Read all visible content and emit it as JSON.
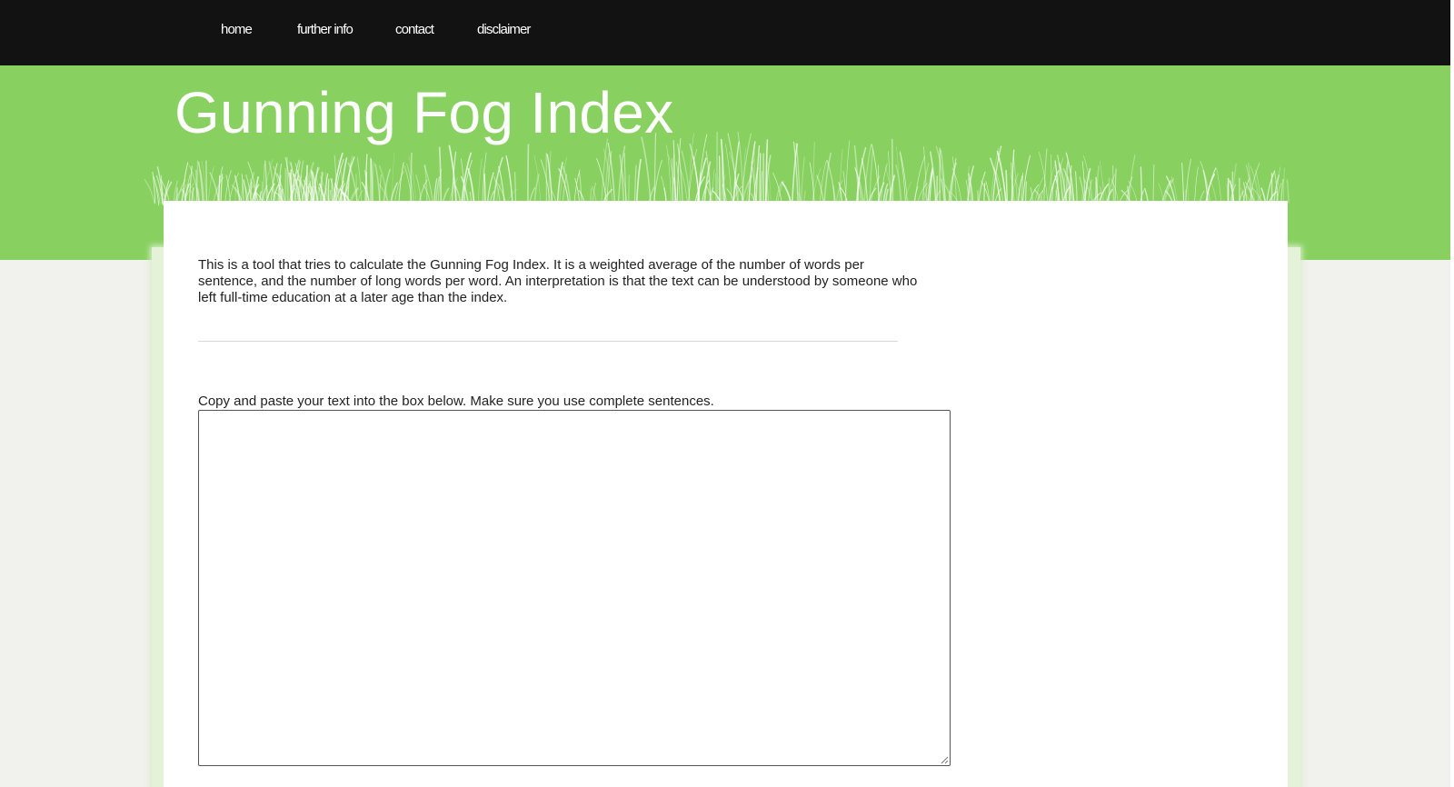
{
  "nav": {
    "items": [
      {
        "label": "home"
      },
      {
        "label": "further info"
      },
      {
        "label": "contact"
      },
      {
        "label": "disclaimer"
      }
    ]
  },
  "header": {
    "title": "Gunning Fog Index"
  },
  "main": {
    "intro": "This is a tool that tries to calculate the Gunning Fog Index. It is a weighted average of the number of words per sentence, and the number of long words per word. An interpretation is that the text can be understood by someone who left full-time education at a later age than the index.",
    "instructions": "Copy and paste your text into the box below. Make sure you use complete sentences.",
    "text_input": {
      "value": "",
      "placeholder": ""
    }
  },
  "colors": {
    "nav_background": "#121212",
    "banner_green": "#88d160",
    "page_background": "#f1f1ed",
    "content_background": "#ffffff"
  },
  "icons": {
    "banner_decoration": "grass-icon",
    "textarea_resize": "resize-grip-icon"
  }
}
